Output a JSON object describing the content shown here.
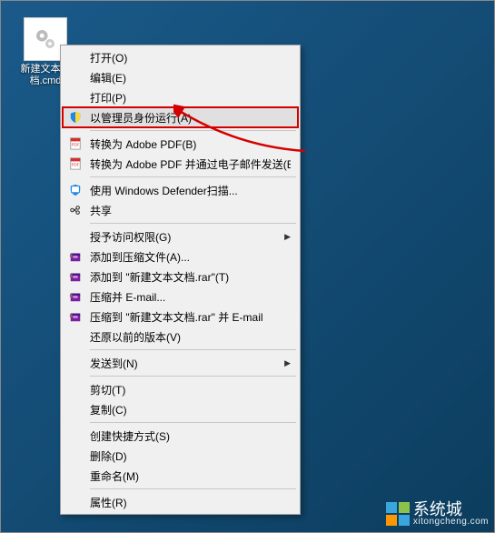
{
  "desktop": {
    "file_label": "新建文本文档.cmd"
  },
  "context_menu": {
    "items": [
      {
        "label": "打开(O)",
        "icon": "",
        "submenu": false
      },
      {
        "label": "编辑(E)",
        "icon": "",
        "submenu": false
      },
      {
        "label": "打印(P)",
        "icon": "",
        "submenu": false
      },
      {
        "label": "以管理员身份运行(A)",
        "icon": "shield",
        "submenu": false,
        "highlighted": true
      },
      {
        "sep": true
      },
      {
        "label": "转换为 Adobe PDF(B)",
        "icon": "pdf",
        "submenu": false
      },
      {
        "label": "转换为 Adobe PDF 并通过电子邮件发送(E)",
        "icon": "pdf",
        "submenu": false
      },
      {
        "sep": true
      },
      {
        "label": "使用 Windows Defender扫描...",
        "icon": "defender",
        "submenu": false
      },
      {
        "label": "共享",
        "icon": "share",
        "submenu": false
      },
      {
        "sep": true
      },
      {
        "label": "授予访问权限(G)",
        "icon": "",
        "submenu": true
      },
      {
        "label": "添加到压缩文件(A)...",
        "icon": "winrar",
        "submenu": false
      },
      {
        "label": "添加到 \"新建文本文档.rar\"(T)",
        "icon": "winrar",
        "submenu": false
      },
      {
        "label": "压缩并 E-mail...",
        "icon": "winrar",
        "submenu": false
      },
      {
        "label": "压缩到 \"新建文本文档.rar\" 并 E-mail",
        "icon": "winrar",
        "submenu": false
      },
      {
        "label": "还原以前的版本(V)",
        "icon": "",
        "submenu": false
      },
      {
        "sep": true
      },
      {
        "label": "发送到(N)",
        "icon": "",
        "submenu": true
      },
      {
        "sep": true
      },
      {
        "label": "剪切(T)",
        "icon": "",
        "submenu": false
      },
      {
        "label": "复制(C)",
        "icon": "",
        "submenu": false
      },
      {
        "sep": true
      },
      {
        "label": "创建快捷方式(S)",
        "icon": "",
        "submenu": false
      },
      {
        "label": "删除(D)",
        "icon": "",
        "submenu": false
      },
      {
        "label": "重命名(M)",
        "icon": "",
        "submenu": false
      },
      {
        "sep": true
      },
      {
        "label": "属性(R)",
        "icon": "",
        "submenu": false
      }
    ]
  },
  "watermark": {
    "brand": "系统城",
    "url": "xitongcheng.com"
  }
}
